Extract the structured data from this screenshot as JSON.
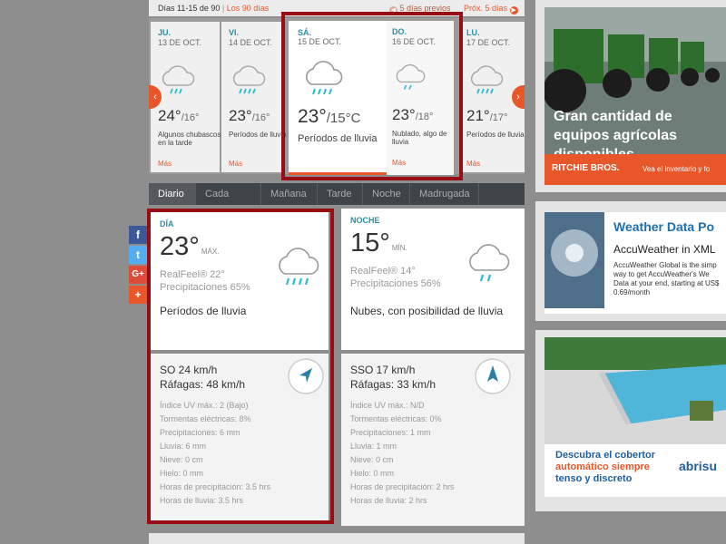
{
  "topbar": {
    "days_label": "Días 11-15 de 90",
    "sep": "|",
    "link_90": "Los 90 días",
    "prev_label": "5 días previos",
    "next_label": "Próx. 5 días"
  },
  "days": [
    {
      "name": "JU.",
      "date": "13 DE OCT.",
      "hi": "24°",
      "lo": "/16°",
      "phrase": "Algunos chubascos en la tarde",
      "more": "Más"
    },
    {
      "name": "VI.",
      "date": "14 DE OCT.",
      "hi": "23°",
      "lo": "/16°",
      "phrase": "Períodos de lluvia",
      "more": "Más"
    },
    {
      "name": "SÁ.",
      "date": "15 DE OCT.",
      "hi": "23°",
      "lo": "/15°C",
      "phrase": "Períodos de lluvia"
    },
    {
      "name": "DO.",
      "date": "16 DE OCT.",
      "hi": "23°",
      "lo": "/18°",
      "phrase": "Nublado, algo de lluvia",
      "more": "Más"
    },
    {
      "name": "LU.",
      "date": "17 DE OCT.",
      "hi": "21°",
      "lo": "/17°",
      "phrase": "Períodos de lluvia",
      "more": "Más"
    }
  ],
  "tabs": [
    "Diario",
    "Cada hora",
    "Mañana",
    "Tarde",
    "Noche",
    "Madrugada"
  ],
  "share": [
    "f",
    "t",
    "G+",
    "+"
  ],
  "day_panel": {
    "label": "DÍA",
    "temp": "23°",
    "unit": "MÁX.",
    "realfeel": "RealFeel® 22°",
    "precip": "Precipitaciones 65%",
    "phrase": "Períodos de lluvia",
    "wind": "SO 24 km/h",
    "gusts": "Ráfagas: 48 km/h",
    "stats": [
      "Índice UV máx.: 2 (Bajo)",
      "Tormentas eléctricas: 8%",
      "Precipitaciones: 6 mm",
      "Lluvia: 6 mm",
      "Nieve: 0 cm",
      "Hielo: 0 mm",
      "Horas de precipitación: 3.5 hrs",
      "Horas de lluvia: 3.5 hrs"
    ]
  },
  "night_panel": {
    "label": "NOCHE",
    "temp": "15°",
    "unit": "MÍN.",
    "realfeel": "RealFeel® 14°",
    "precip": "Precipitaciones 56%",
    "phrase": "Nubes, con posibilidad de lluvia",
    "wind": "SSO 17 km/h",
    "gusts": "Ráfagas: 33 km/h",
    "stats": [
      "Índice UV máx.: N/D",
      "Tormentas eléctricas: 0%",
      "Precipitaciones: 1 mm",
      "Lluvia: 1 mm",
      "Nieve: 0 cm",
      "Hielo: 0 mm",
      "Horas de precipitación: 2 hrs",
      "Horas de lluvia: 2 hrs"
    ]
  },
  "ads": {
    "ad1_headline": "Gran cantidad de equipos agrícolas disponibles",
    "ad1_brand": "RITCHIE BROS.",
    "ad1_cta": "Vea el inventario y fo",
    "ad2_title": "Weather Data Po",
    "ad2_sub": "AccuWeather in XML",
    "ad2_body": "AccuWeather Global is the simp way to get AccuWeather's We Data at your end, starting at US$ 0.69/month",
    "ad3_line1": "Descubra el cobertor",
    "ad3_line2": "automático siempre",
    "ad3_line3": "tenso y discreto",
    "ad3_brand": "abrisu"
  },
  "colors": {
    "accent": "#e8572a",
    "highlight": "#990d14",
    "label_blue": "#2a8fa6",
    "rain_icon": "#2bbbd0"
  }
}
